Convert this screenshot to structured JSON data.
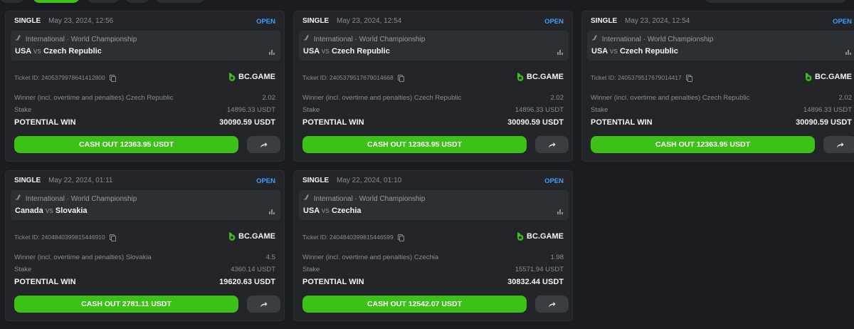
{
  "brand_color": "#3bc117",
  "status_color": "#3aa0ff",
  "cards": [
    {
      "type": "SINGLE",
      "date": "May 23, 2024, 12:56",
      "status": "OPEN",
      "league": "International · World Championship",
      "home": "USA",
      "vs": "vs",
      "away": "Czech Republic",
      "ticket": "Ticket ID: 2405379978641412800",
      "brand": "BC.GAME",
      "selection": "Winner (incl. overtime and penalties) Czech Republic",
      "odds": "2.02",
      "stake_label": "Stake",
      "stake": "14896.33 USDT",
      "win_label": "POTENTIAL WIN",
      "win": "30090.59 USDT",
      "cashout": "CASH OUT 12363.95 USDT"
    },
    {
      "type": "SINGLE",
      "date": "May 23, 2024, 12:54",
      "status": "OPEN",
      "league": "International · World Championship",
      "home": "USA",
      "vs": "vs",
      "away": "Czech Republic",
      "ticket": "Ticket ID: 2405379517679014668",
      "brand": "BC.GAME",
      "selection": "Winner (incl. overtime and penalties) Czech Republic",
      "odds": "2.02",
      "stake_label": "Stake",
      "stake": "14896.33 USDT",
      "win_label": "POTENTIAL WIN",
      "win": "30090.59 USDT",
      "cashout": "CASH OUT 12363.95 USDT"
    },
    {
      "type": "SINGLE",
      "date": "May 23, 2024, 12:54",
      "status": "OPEN",
      "league": "International · World Championship",
      "home": "USA",
      "vs": "vs",
      "away": "Czech Republic",
      "ticket": "Ticket ID: 2405379517679014417",
      "brand": "BC.GAME",
      "selection": "Winner (incl. overtime and penalties) Czech Republic",
      "odds": "2.02",
      "stake_label": "Stake",
      "stake": "14896.33 USDT",
      "win_label": "POTENTIAL WIN",
      "win": "30090.59 USDT",
      "cashout": "CASH OUT 12363.95 USDT"
    },
    {
      "type": "SINGLE",
      "date": "May 22, 2024, 01:11",
      "status": "OPEN",
      "league": "International · World Championship",
      "home": "Canada",
      "vs": "vs",
      "away": "Slovakia",
      "ticket": "Ticket ID: 2404840399815446910",
      "brand": "BC.GAME",
      "selection": "Winner (incl. overtime and penalties) Slovakia",
      "odds": "4.5",
      "stake_label": "Stake",
      "stake": "4360.14 USDT",
      "win_label": "POTENTIAL WIN",
      "win": "19620.63 USDT",
      "cashout": "CASH OUT 2781.11 USDT"
    },
    {
      "type": "SINGLE",
      "date": "May 22, 2024, 01:10",
      "status": "OPEN",
      "league": "International · World Championship",
      "home": "USA",
      "vs": "vs",
      "away": "Czechia",
      "ticket": "Ticket ID: 2404840399815446599",
      "brand": "BC.GAME",
      "selection": "Winner (incl. overtime and penalties) Czechia",
      "odds": "1.98",
      "stake_label": "Stake",
      "stake": "15571.94 USDT",
      "win_label": "POTENTIAL WIN",
      "win": "30832.44 USDT",
      "cashout": "CASH OUT 12542.07 USDT"
    }
  ]
}
